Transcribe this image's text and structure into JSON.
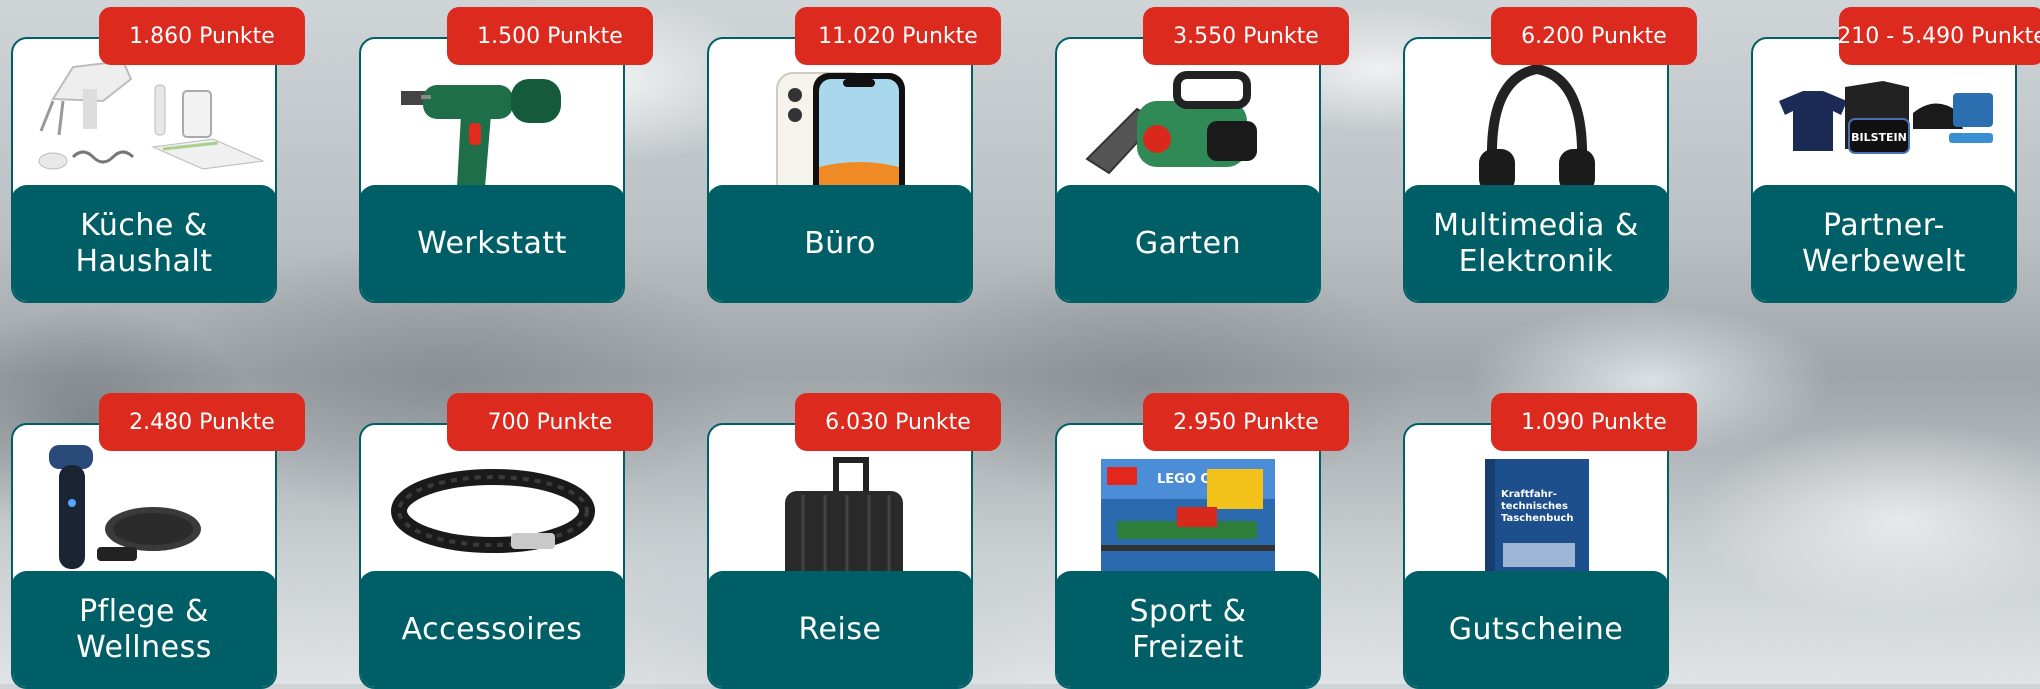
{
  "categories": [
    {
      "label": "Küche & Haushalt",
      "points": "1.860 Punkte",
      "image": "kitchen-appliances-image"
    },
    {
      "label": "Werkstatt",
      "points": "1.500 Punkte",
      "image": "cordless-drill-image"
    },
    {
      "label": "Büro",
      "points": "11.020 Punkte",
      "image": "smartphone-image"
    },
    {
      "label": "Garten",
      "points": "3.550 Punkte",
      "image": "chainsaw-image"
    },
    {
      "label": "Multimedia & Elektronik",
      "points": "6.200 Punkte",
      "image": "headphones-image"
    },
    {
      "label": "Partner-Werbewelt",
      "points": "210 - 5.490 Punkte",
      "image": "merchandise-image",
      "logo_text": "BILSTEIN"
    },
    {
      "label": "Pflege & Wellness",
      "points": "2.480 Punkte",
      "image": "shaver-image"
    },
    {
      "label": "Accessoires",
      "points": "700 Punkte",
      "image": "bracelet-image"
    },
    {
      "label": "Reise",
      "points": "6.030 Punkte",
      "image": "suitcase-image"
    },
    {
      "label": "Sport & Freizeit",
      "points": "2.950 Punkte",
      "image": "lego-train-box-image",
      "logo_text": "LEGO CITY"
    },
    {
      "label": "Gutscheine",
      "points": "1.090 Punkte",
      "image": "handbook-image",
      "book_title": "Kraftfahr-technisches Taschenbuch"
    }
  ],
  "colors": {
    "card_teal": "#005f66",
    "badge_red": "#dc2a1e",
    "text_white": "#ffffff"
  }
}
